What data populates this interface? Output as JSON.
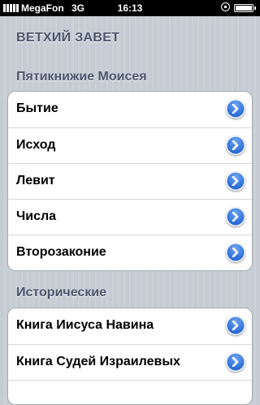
{
  "status_bar": {
    "carrier": "MegaFon",
    "network": "3G",
    "time": "16:13",
    "signal_bars": 5,
    "icons": [
      "signal-icon",
      "orientation-lock-icon",
      "battery-icon"
    ]
  },
  "page": {
    "title": "ВЕТХИЙ ЗАВЕТ"
  },
  "sections": [
    {
      "header": "Пятикнижие Моисея",
      "items": [
        {
          "label": "Бытие"
        },
        {
          "label": "Исход"
        },
        {
          "label": "Левит"
        },
        {
          "label": "Числа"
        },
        {
          "label": "Второзаконие"
        }
      ]
    },
    {
      "header": "Исторические",
      "items": [
        {
          "label": "Книга Иисуса Навина"
        },
        {
          "label": "Книга Судей Израилевых"
        }
      ]
    }
  ],
  "colors": {
    "background": "#c5ccd4",
    "header_text": "#4c566c",
    "disclosure_blue": "#2f6fd8"
  }
}
